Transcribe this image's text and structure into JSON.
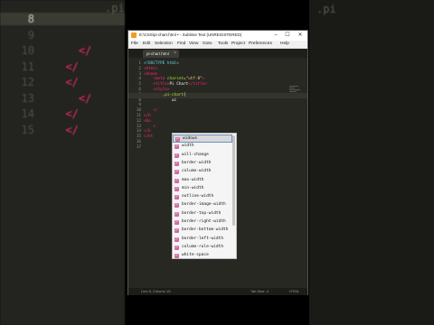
{
  "background": {
    "editor_lines": [
      {
        "num": "8",
        "code": "",
        "current": true
      },
      {
        "num": "9",
        "code": ""
      },
      {
        "num": "10",
        "code": "    </"
      },
      {
        "num": "11",
        "code": "  </"
      },
      {
        "num": "12",
        "code": "  </"
      },
      {
        "num": "13",
        "code": "    </"
      },
      {
        "num": "14",
        "code": "  </"
      },
      {
        "num": "15",
        "code": "  </"
      }
    ],
    "top_fragment": ".pi",
    "right_fragment": ".pi"
  },
  "window": {
    "title": "E:\\CSS\\pi-chart.html • - Sublime Text (UNREGISTERED)",
    "controls": {
      "minimize": "–",
      "maximize": "☐",
      "close": "✕"
    },
    "menu": [
      "File",
      "Edit",
      "Selection",
      "Find",
      "View",
      "Goto",
      "Tools",
      "Project",
      "Preferences",
      "Help"
    ],
    "tab": {
      "label": "pi-chart.html",
      "close": "×"
    }
  },
  "code": {
    "lines": [
      {
        "num": "1",
        "html": "<span class='t-doc'>&lt;!DOCTYPE html&gt;</span>"
      },
      {
        "num": "2",
        "html": "<span class='t-tag'>&lt;html&gt;</span>"
      },
      {
        "num": "3",
        "html": "<span class='t-tag'>&lt;head&gt;</span>"
      },
      {
        "num": "4",
        "html": "    <span class='t-tag'>&lt;meta</span> <span class='t-attr'>charset</span>=<span class='t-str'>\"utf-8\"</span><span class='t-tag'>&gt;</span>"
      },
      {
        "num": "5",
        "html": "    <span class='t-tag'>&lt;title&gt;</span>Pi Chart<span class='t-tag'>&lt;/title&gt;</span>"
      },
      {
        "num": "6",
        "html": "    <span class='t-tag'>&lt;style&gt;</span>"
      },
      {
        "num": "7",
        "html": "        <span class='t-sel'>.pi-chart</span>{"
      },
      {
        "num": "8",
        "html": "            wi"
      },
      {
        "num": "9",
        "html": ""
      },
      {
        "num": "10",
        "html": "    <span class='t-tag'>&lt;/</span>"
      },
      {
        "num": "11",
        "html": "<span class='t-tag'>&lt;/h</span>"
      },
      {
        "num": "12",
        "html": "<span class='t-tag'>&lt;bo</span>"
      },
      {
        "num": "13",
        "html": "    <span class='t-tag'>&lt;</span>"
      },
      {
        "num": "14",
        "html": "<span class='t-tag'>&lt;/b</span>"
      },
      {
        "num": "15",
        "html": "<span class='t-tag'>&lt;/ht</span>"
      },
      {
        "num": "16",
        "html": ""
      },
      {
        "num": "17",
        "html": ""
      }
    ]
  },
  "autocomplete": {
    "kind_letter": "P",
    "items": [
      "widows",
      "width",
      "will-change",
      "border-width",
      "column-width",
      "max-width",
      "min-width",
      "outline-width",
      "border-image-width",
      "border-top-width",
      "border-right-width",
      "border-bottom-width",
      "border-left-width",
      "column-rule-width",
      "white-space"
    ],
    "selected_index": 0
  },
  "status": {
    "position": "Line 8, Column 15",
    "tab_size": "Tab Size: 4",
    "syntax": "HTML"
  }
}
